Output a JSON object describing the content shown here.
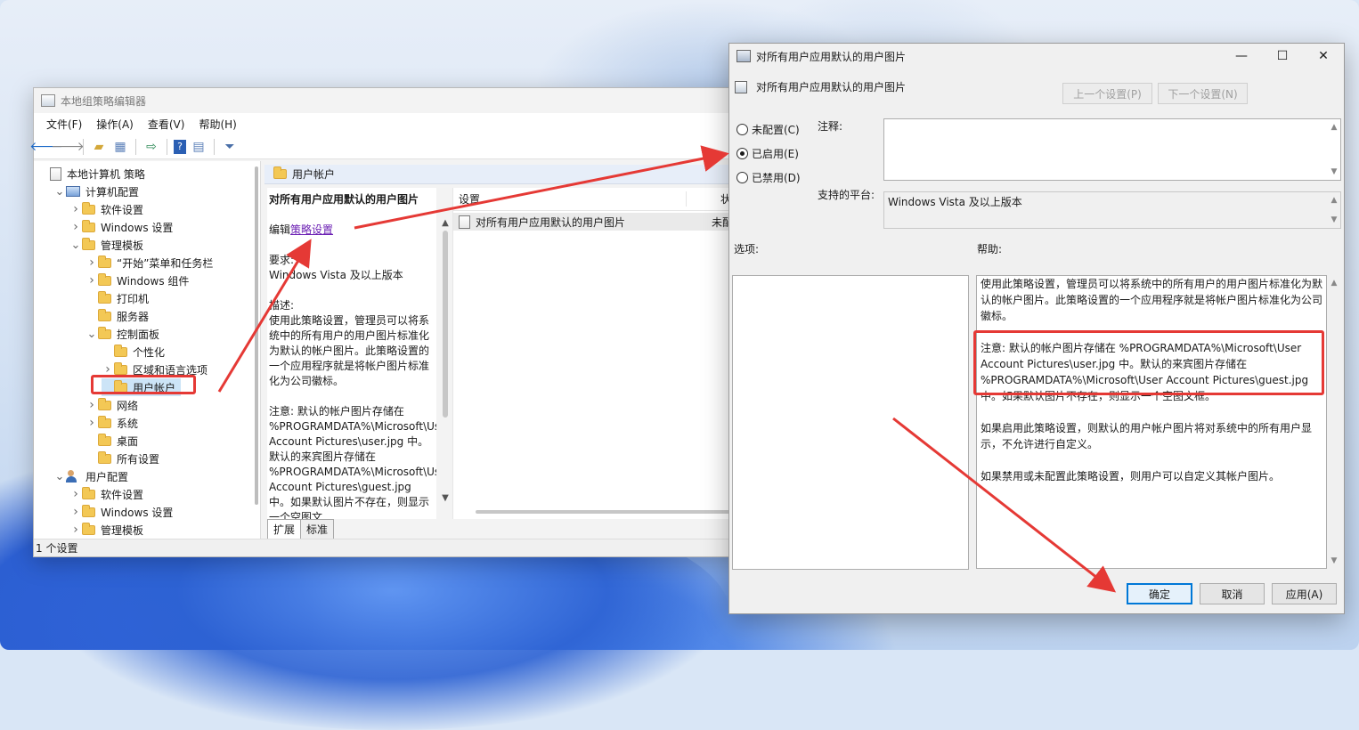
{
  "colors": {
    "accent": "#0078d7",
    "annotation": "#e53935",
    "link": "#6b1fb3"
  },
  "editor": {
    "title": "本地组策略编辑器",
    "menu": [
      "文件(F)",
      "操作(A)",
      "查看(V)",
      "帮助(H)"
    ],
    "toolbar_icons": [
      "back-arrow-icon",
      "forward-arrow-icon",
      "folder-up-icon",
      "show-hide-tree-icon",
      "export-list-icon",
      "help-icon",
      "properties-icon",
      "filter-icon"
    ],
    "tree": [
      {
        "label": "本地计算机 策略",
        "level": 0,
        "icon": "policy-icon",
        "chevron": ""
      },
      {
        "label": "计算机配置",
        "level": 1,
        "icon": "computer-icon",
        "chevron": "v"
      },
      {
        "label": "软件设置",
        "level": 2,
        "icon": "folder-icon",
        "chevron": ">"
      },
      {
        "label": "Windows 设置",
        "level": 2,
        "icon": "folder-icon",
        "chevron": ">"
      },
      {
        "label": "管理模板",
        "level": 2,
        "icon": "folder-icon",
        "chevron": "v"
      },
      {
        "label": "“开始”菜单和任务栏",
        "level": 3,
        "icon": "folder-icon",
        "chevron": ">"
      },
      {
        "label": "Windows 组件",
        "level": 3,
        "icon": "folder-icon",
        "chevron": ">"
      },
      {
        "label": "打印机",
        "level": 3,
        "icon": "folder-icon",
        "chevron": ""
      },
      {
        "label": "服务器",
        "level": 3,
        "icon": "folder-icon",
        "chevron": ""
      },
      {
        "label": "控制面板",
        "level": 3,
        "icon": "folder-icon",
        "chevron": "v"
      },
      {
        "label": "个性化",
        "level": 4,
        "icon": "folder-icon",
        "chevron": ""
      },
      {
        "label": "区域和语言选项",
        "level": 4,
        "icon": "folder-icon",
        "chevron": ">"
      },
      {
        "label": "用户帐户",
        "level": 4,
        "icon": "folder-icon",
        "chevron": "",
        "selected": true
      },
      {
        "label": "网络",
        "level": 3,
        "icon": "folder-icon",
        "chevron": ">"
      },
      {
        "label": "系统",
        "level": 3,
        "icon": "folder-icon",
        "chevron": ">"
      },
      {
        "label": "桌面",
        "level": 3,
        "icon": "folder-icon",
        "chevron": ""
      },
      {
        "label": "所有设置",
        "level": 3,
        "icon": "folder-icon",
        "chevron": ""
      },
      {
        "label": "用户配置",
        "level": 1,
        "icon": "users-icon",
        "chevron": "v"
      },
      {
        "label": "软件设置",
        "level": 2,
        "icon": "folder-icon",
        "chevron": ">"
      },
      {
        "label": "Windows 设置",
        "level": 2,
        "icon": "folder-icon",
        "chevron": ">"
      },
      {
        "label": "管理模板",
        "level": 2,
        "icon": "folder-icon",
        "chevron": ">"
      }
    ],
    "folder_header": "用户帐户",
    "description": {
      "policy_title": "对所有用户应用默认的用户图片",
      "edit_prefix": "编辑",
      "edit_link": "策略设置",
      "requirements_label": "要求:",
      "requirements_value": "Windows Vista 及以上版本",
      "description_label": "描述:",
      "description_text": "使用此策略设置，管理员可以将系统中的所有用户的用户图片标准化为默认的帐户图片。此策略设置的一个应用程序就是将帐户图片标准化为公司徽标。",
      "note_text": "注意: 默认的帐户图片存储在 %PROGRAMDATA%\\Microsoft\\User Account Pictures\\user.jpg 中。默认的来宾图片存储在 %PROGRAMDATA%\\Microsoft\\User Account Pictures\\guest.jpg 中。如果默认图片不存在，则显示一个空图文"
    },
    "list": {
      "col_setting": "设置",
      "col_state": "状态",
      "rows": [
        {
          "name": "对所有用户应用默认的用户图片",
          "state": "未配置"
        }
      ]
    },
    "tabs": [
      "扩展",
      "标准"
    ],
    "status": "1 个设置"
  },
  "dialog": {
    "title": "对所有用户应用默认的用户图片",
    "policy_name": "对所有用户应用默认的用户图片",
    "prev_button": "上一个设置(P)",
    "next_button": "下一个设置(N)",
    "radios": [
      {
        "label": "未配置(C)",
        "checked": false
      },
      {
        "label": "已启用(E)",
        "checked": true
      },
      {
        "label": "已禁用(D)",
        "checked": false
      }
    ],
    "comment_label": "注释:",
    "comment_value": "",
    "platform_label": "支持的平台:",
    "platform_value": "Windows Vista 及以上版本",
    "options_label": "选项:",
    "help_label": "帮助:",
    "help_paragraphs": [
      "使用此策略设置，管理员可以将系统中的所有用户的用户图片标准化为默认的帐户图片。此策略设置的一个应用程序就是将帐户图片标准化为公司徽标。",
      "注意: 默认的帐户图片存储在 %PROGRAMDATA%\\Microsoft\\User Account Pictures\\user.jpg 中。默认的来宾图片存储在 %PROGRAMDATA%\\Microsoft\\User Account Pictures\\guest.jpg 中。如果默认图片不存在，则显示一个空图文框。",
      "如果启用此策略设置，则默认的用户帐户图片将对系统中的所有用户显示，不允许进行自定义。",
      "如果禁用或未配置此策略设置，则用户可以自定义其帐户图片。"
    ],
    "ok_button": "确定",
    "cancel_button": "取消",
    "apply_button": "应用(A)"
  }
}
